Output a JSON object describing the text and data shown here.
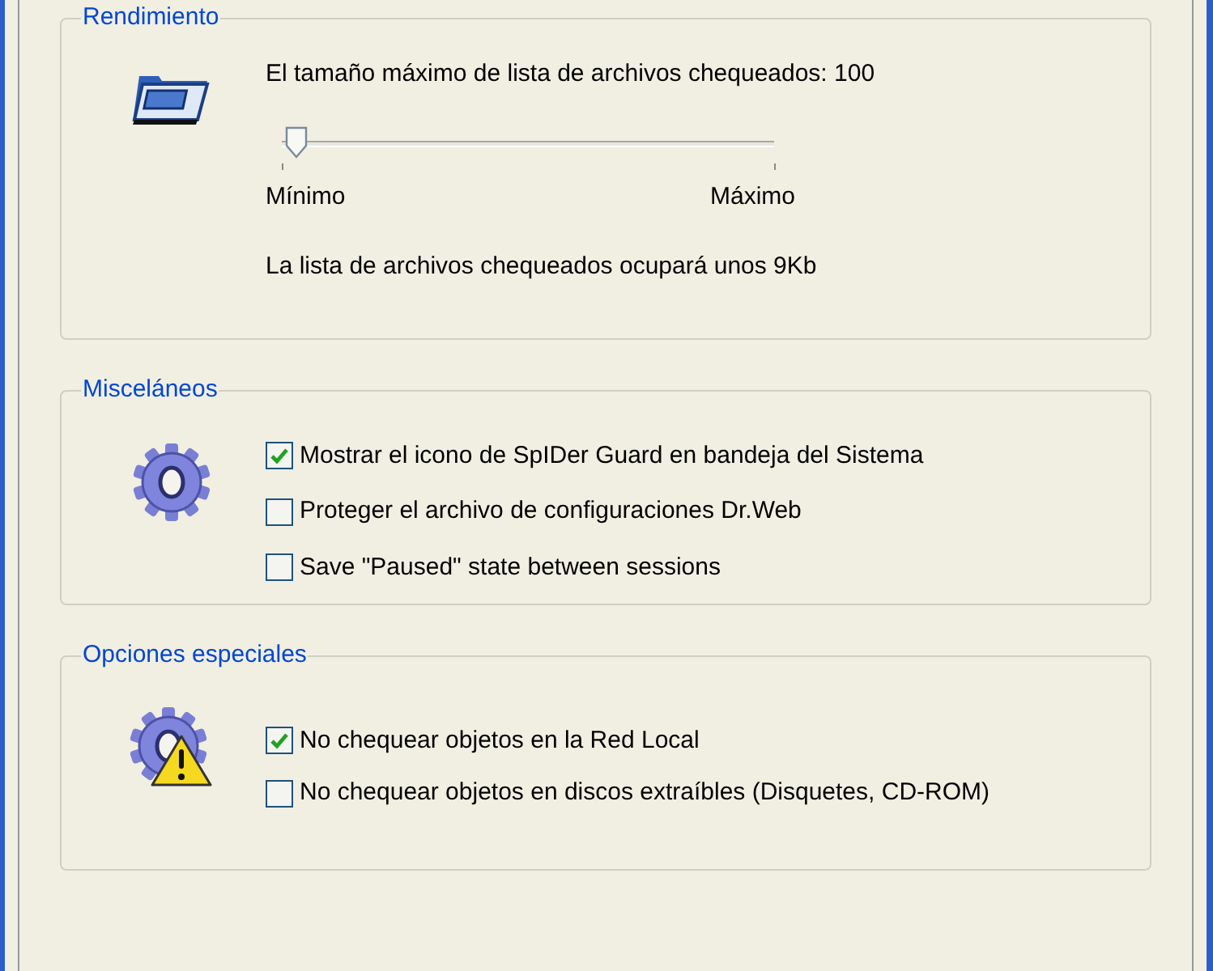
{
  "groups": [
    {
      "kind": "slider",
      "title": "Rendimiento",
      "label": "El tamaño máximo de lista de archivos chequeados: 100",
      "slider": {
        "level": 0.03,
        "min_label": "Mínimo",
        "max_label": "Máximo"
      },
      "note": "La lista de archivos chequeados ocupará unos 9Kb"
    },
    {
      "kind": "checks",
      "title": "Misceláneos",
      "options": [
        {
          "label": "Mostrar el icono de SpIDer Guard en bandeja del Sistema",
          "checked": true
        },
        {
          "label": "Proteger el archivo de configuraciones Dr.Web",
          "checked": false
        },
        {
          "label": "Save \"Paused\" state between sessions",
          "checked": false
        }
      ]
    },
    {
      "kind": "warning",
      "title": "Opciones especiales",
      "options": [
        {
          "label": "No chequear objetos en la Red Local",
          "checked": true
        },
        {
          "label": "No chequear objetos en discos extraíbles (Disquetes, CD-ROM)",
          "checked": false
        }
      ]
    }
  ]
}
